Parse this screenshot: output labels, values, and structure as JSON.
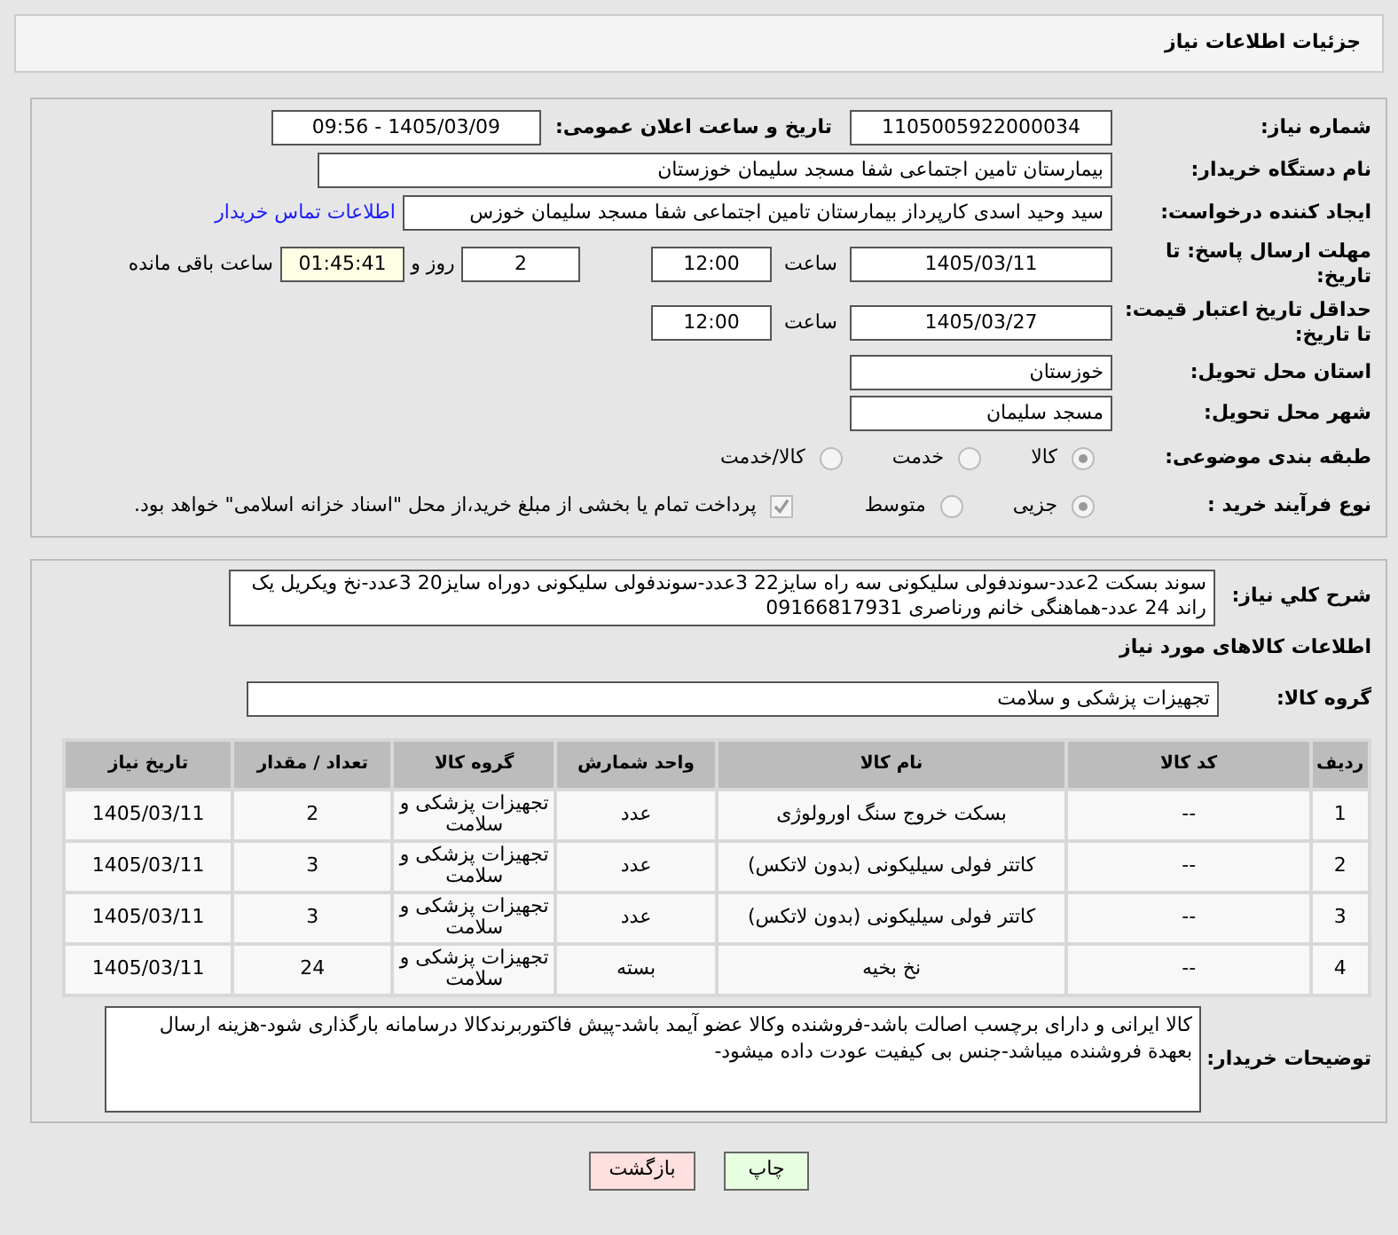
{
  "header": {
    "title": "جزئیات اطلاعات نیاز"
  },
  "need_number": {
    "label": "شماره نیاز:",
    "value": "1105005922000034"
  },
  "announce": {
    "label": "تاریخ و ساعت اعلان عمومی:",
    "value": "1405/03/09 - 09:56"
  },
  "buyer_org": {
    "label": "نام دستگاه خریدار:",
    "value": "بیمارستان تامین اجتماعی شفا مسجد سلیمان خوزستان"
  },
  "requester": {
    "label": "ایجاد کننده درخواست:",
    "value": "سید وحید اسدی کارپرداز بیمارستان تامین اجتماعی شفا مسجد سلیمان خوزس",
    "link": "اطلاعات تماس خریدار"
  },
  "deadline": {
    "label": "مهلت ارسال پاسخ: تا تاریخ:",
    "date": "1405/03/11",
    "time_label": "ساعت",
    "time": "12:00",
    "days": "2",
    "days_label": "روز و",
    "remaining": "01:45:41",
    "remaining_label": "ساعت باقی مانده"
  },
  "validity": {
    "label": "حداقل تاریخ اعتبار قیمت: تا تاریخ:",
    "date": "1405/03/27",
    "time_label": "ساعت",
    "time": "12:00"
  },
  "province": {
    "label": "استان محل تحویل:",
    "value": "خوزستان"
  },
  "city": {
    "label": "شهر محل تحویل:",
    "value": "مسجد سلیمان"
  },
  "category": {
    "label": "طبقه بندی موضوعی:",
    "options": [
      {
        "label": "کالا",
        "selected": true
      },
      {
        "label": "خدمت",
        "selected": false
      },
      {
        "label": "کالا/خدمت",
        "selected": false
      }
    ]
  },
  "process": {
    "label": "نوع فرآیند خرید :",
    "options": [
      {
        "label": "جزیی",
        "selected": true
      },
      {
        "label": "متوسط",
        "selected": false
      }
    ],
    "payment": {
      "checked": true,
      "text": "پرداخت تمام یا بخشی از مبلغ خرید،از محل \"اسناد خزانه اسلامی\" خواهد بود."
    }
  },
  "description": {
    "label": "شرح كلي نياز:",
    "value": "سوند بسکت 2عدد-سوندفولی سلیکونی سه راه سایز22 3عدد-سوندفولی سلیکونی دوراه سایز20 3عدد-نخ ویکریل یک راند 24 عدد-هماهنگی خانم ورناصری 09166817931"
  },
  "items_heading": "اطلاعات کالاهای مورد نیاز",
  "goods_group": {
    "label": "گروه کالا:",
    "value": "تجهیزات پزشکی و سلامت"
  },
  "table": {
    "columns": [
      "ردیف",
      "کد کالا",
      "نام کالا",
      "واحد شمارش",
      "گروه کالا",
      "تعداد / مقدار",
      "تاریخ نیاز"
    ],
    "rows": [
      [
        "1",
        "--",
        "بسکت خروج سنگ اورولوژی",
        "عدد",
        "تجهیزات پزشکی و سلامت",
        "2",
        "1405/03/11"
      ],
      [
        "2",
        "--",
        "کاتتر فولی سیلیکونی (بدون لاتکس)",
        "عدد",
        "تجهیزات پزشکی و سلامت",
        "3",
        "1405/03/11"
      ],
      [
        "3",
        "--",
        "کاتتر فولی سیلیکونی (بدون لاتکس)",
        "عدد",
        "تجهیزات پزشکی و سلامت",
        "3",
        "1405/03/11"
      ],
      [
        "4",
        "--",
        "نخ بخیه",
        "بسته",
        "تجهیزات پزشکی و سلامت",
        "24",
        "1405/03/11"
      ]
    ]
  },
  "buyer_notes": {
    "label": "توضیحات خریدار:",
    "value": "کالا ایرانی و دارای برچسب اصالت باشد-فروشنده وکالا عضو آیمد باشد-پیش فاکتوربرندکالا درسامانه بارگذاری شود-هزینه ارسال بعهدة فروشنده میباشد-جنس بی کیفیت عودت داده میشود-"
  },
  "buttons": [
    {
      "kind": "print",
      "label": "چاپ"
    },
    {
      "kind": "back",
      "label": "بازگشت"
    }
  ]
}
